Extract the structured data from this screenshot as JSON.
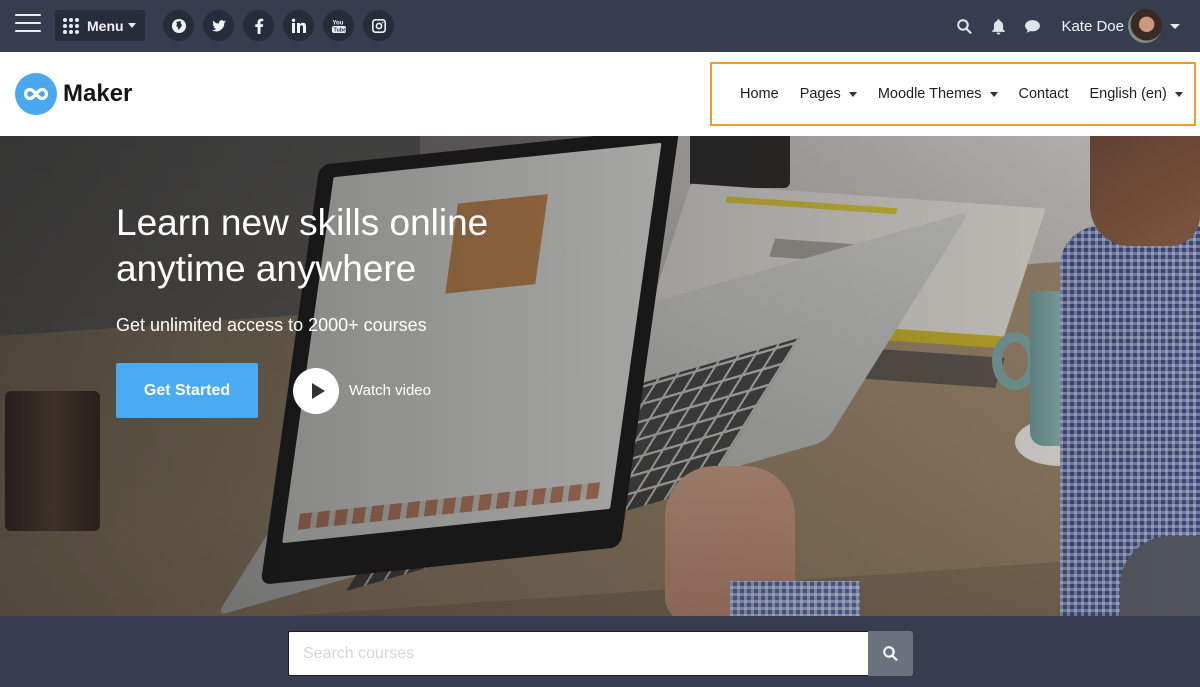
{
  "topbar": {
    "menu_label": "Menu",
    "social_icons": [
      {
        "name": "globe-icon",
        "glyph": "globe"
      },
      {
        "name": "twitter-icon",
        "glyph": "twitter"
      },
      {
        "name": "facebook-icon",
        "glyph": "facebook"
      },
      {
        "name": "linkedin-icon",
        "glyph": "linkedin"
      },
      {
        "name": "youtube-icon",
        "glyph": "youtube"
      },
      {
        "name": "instagram-icon",
        "glyph": "instagram"
      }
    ],
    "user_name": "Kate Doe"
  },
  "navbar": {
    "brand_name": "Maker",
    "items": [
      {
        "label": "Home",
        "dropdown": false
      },
      {
        "label": "Pages",
        "dropdown": true
      },
      {
        "label": "Moodle Themes",
        "dropdown": true
      },
      {
        "label": "Contact",
        "dropdown": false
      },
      {
        "label": "English (en)",
        "dropdown": true
      }
    ],
    "highlight_color": "#f39a2a"
  },
  "hero": {
    "title": "Learn new skills online anytime anywhere",
    "subtitle": "Get unlimited access to 2000+ courses",
    "cta_label": "Get Started",
    "watch_label": "Watch video",
    "cta_color": "#4aabf5"
  },
  "search": {
    "placeholder": "Search courses",
    "value": ""
  },
  "colors": {
    "topbar_bg": "#353d4f",
    "brand_blue": "#4aa8ef"
  }
}
